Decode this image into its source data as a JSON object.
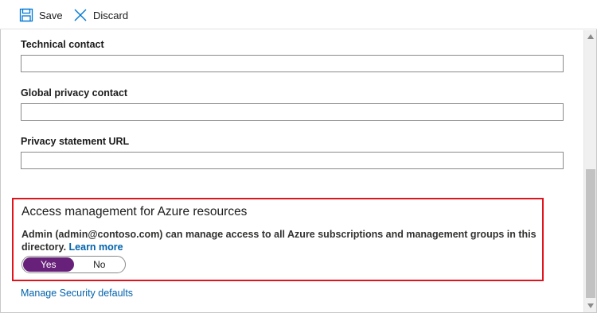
{
  "toolbar": {
    "save_label": "Save",
    "save_icon": "floppy-disk-icon",
    "discard_label": "Discard",
    "discard_icon": "close-icon",
    "icon_color": "#0078d4"
  },
  "fields": [
    {
      "label": "Technical contact",
      "value": ""
    },
    {
      "label": "Global privacy contact",
      "value": ""
    },
    {
      "label": "Privacy statement URL",
      "value": ""
    }
  ],
  "access_management": {
    "title": "Access management for Azure resources",
    "description": "Admin (admin@contoso.com) can manage access to all Azure subscriptions and management groups in this directory.",
    "learn_more": "Learn more",
    "toggle": {
      "yes_label": "Yes",
      "no_label": "No",
      "selected": "Yes",
      "on_color": "#68217a"
    },
    "highlight_color": "#e0141e"
  },
  "manage_security_link": "Manage Security defaults",
  "link_color": "#0062ad"
}
